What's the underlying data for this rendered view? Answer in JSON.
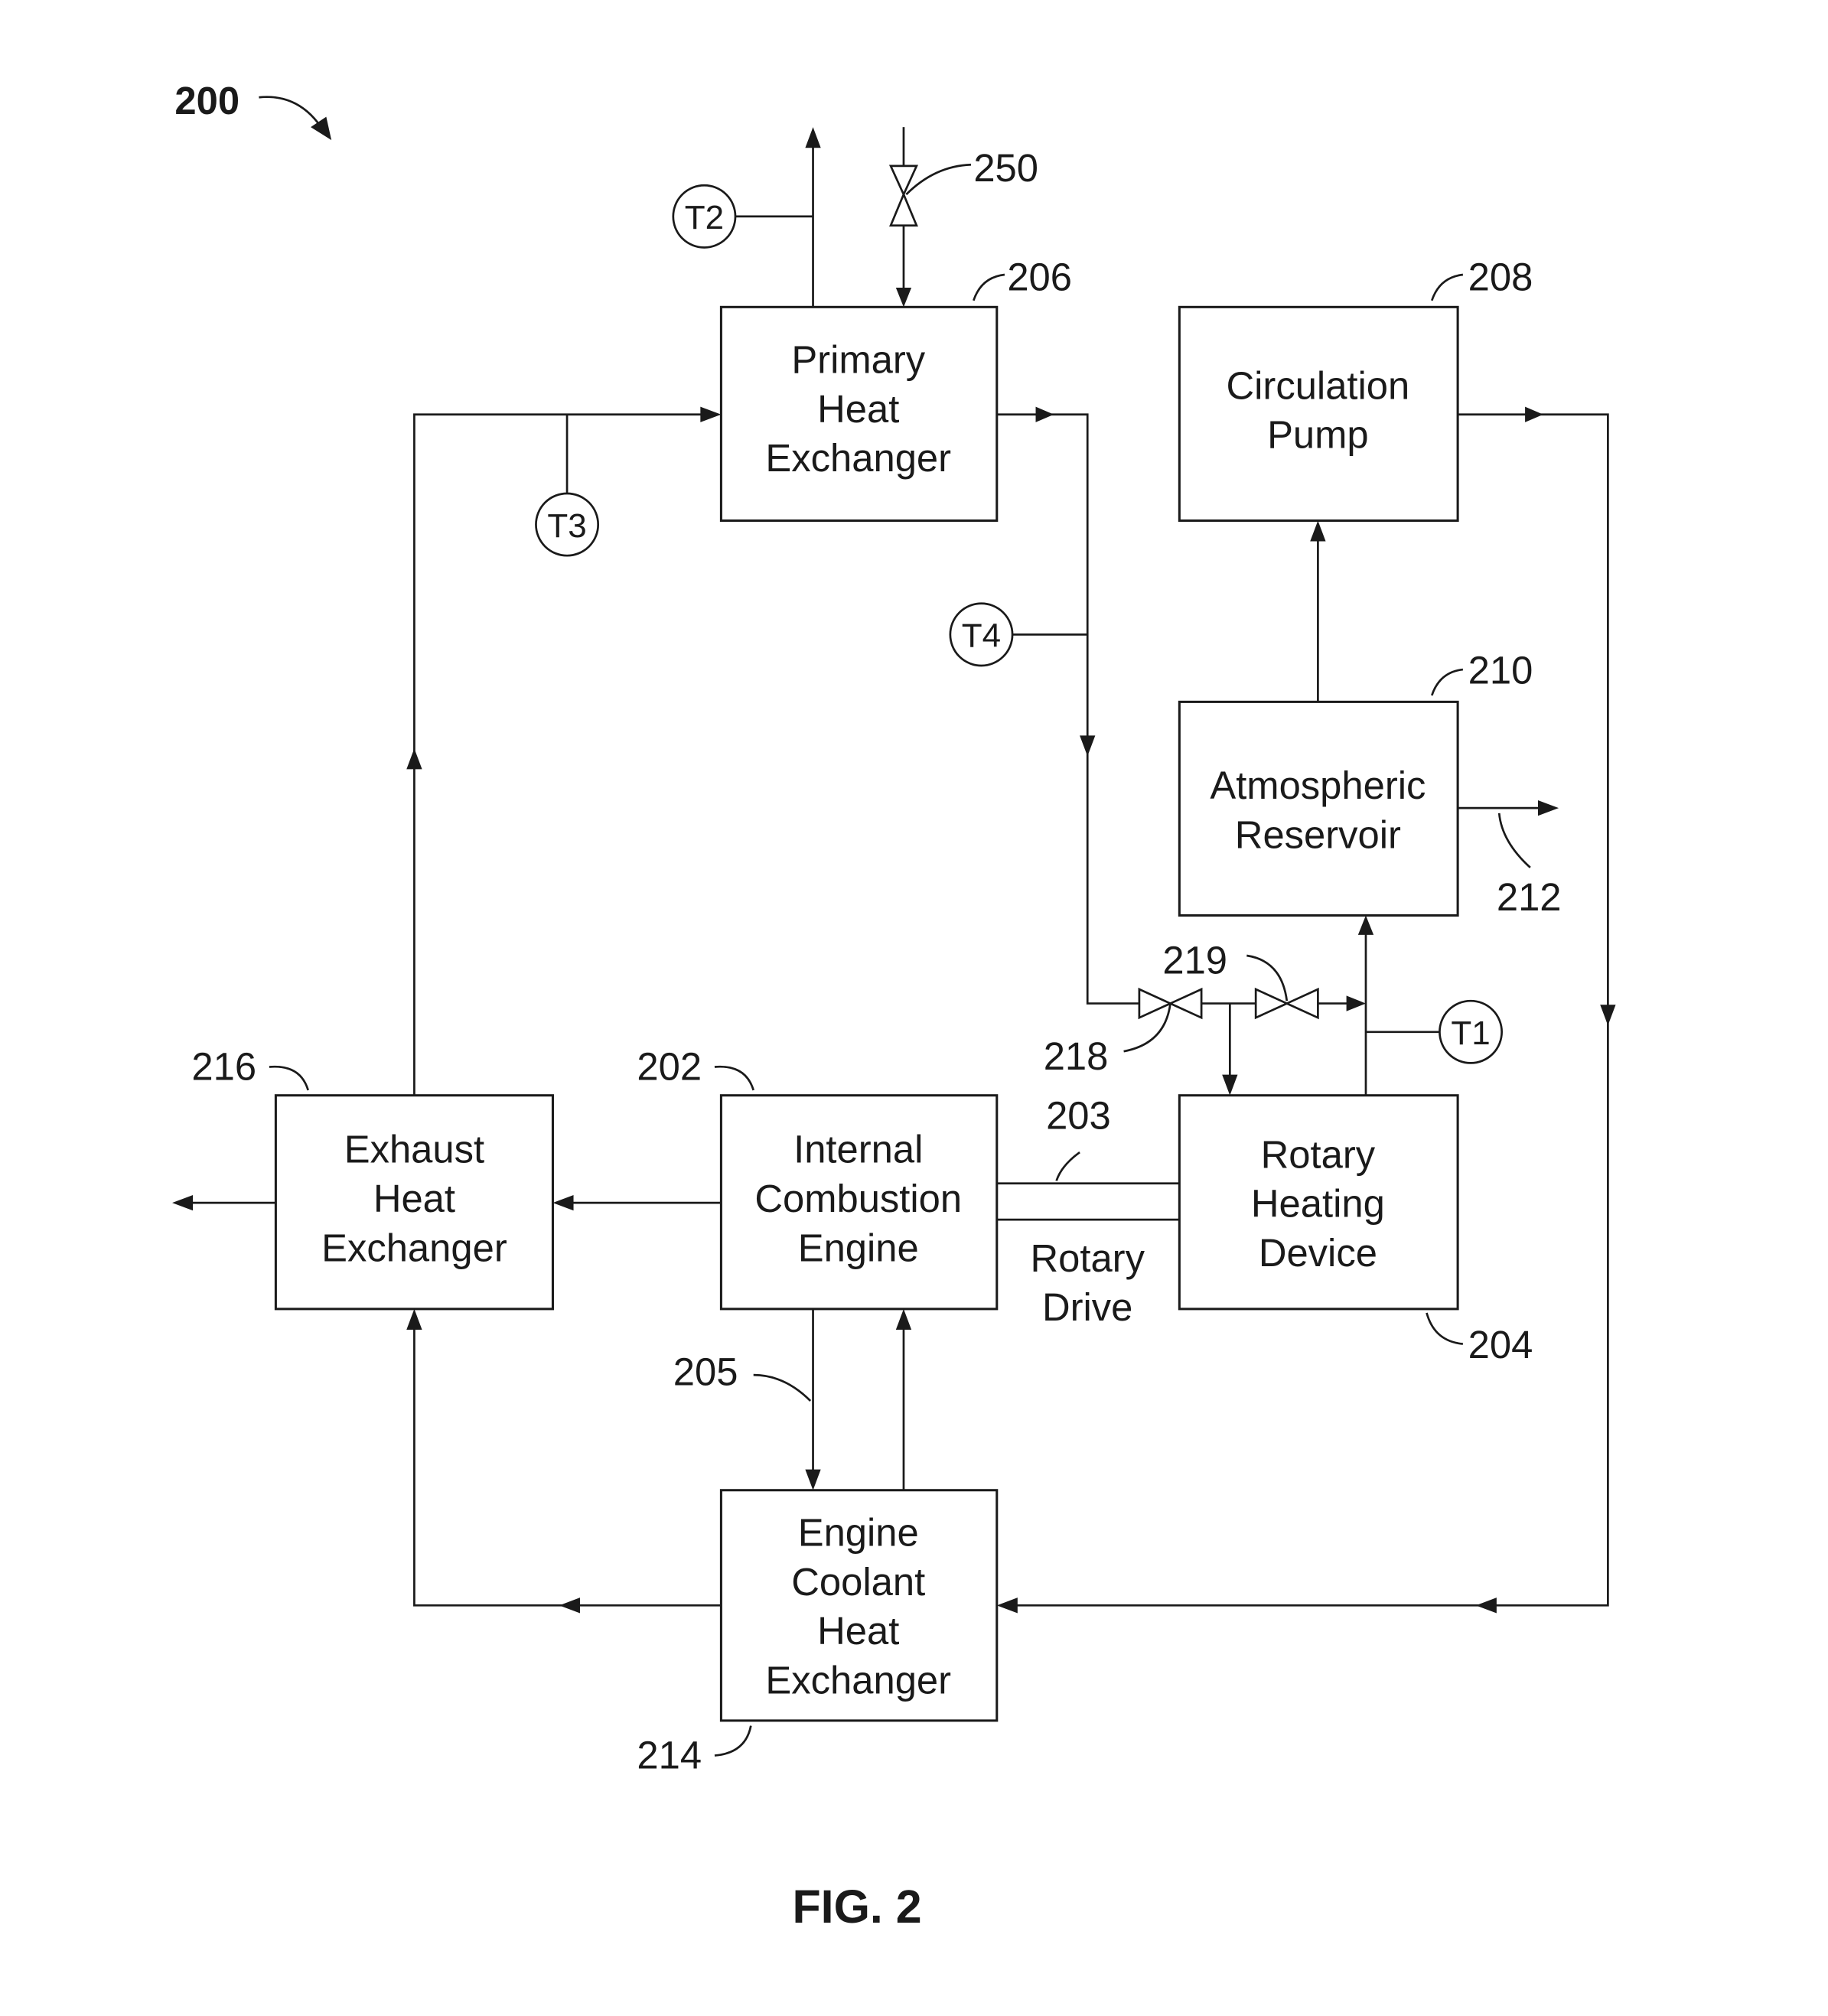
{
  "figure": {
    "number_label": "200",
    "caption": "FIG. 2"
  },
  "components": {
    "primary_hx": {
      "ref": "206",
      "lines": [
        "Primary",
        "Heat",
        "Exchanger"
      ]
    },
    "circulation_pump": {
      "ref": "208",
      "lines": [
        "Circulation",
        "Pump"
      ]
    },
    "atmospheric_reservoir": {
      "ref": "210",
      "lines": [
        "Atmospheric",
        "Reservoir"
      ]
    },
    "exhaust_hx": {
      "ref": "216",
      "lines": [
        "Exhaust",
        "Heat",
        "Exchanger"
      ]
    },
    "engine": {
      "ref": "202",
      "lines": [
        "Internal",
        "Combustion",
        "Engine"
      ]
    },
    "rotary_heater": {
      "ref": "204",
      "lines": [
        "Rotary",
        "Heating",
        "Device"
      ]
    },
    "coolant_hx": {
      "ref": "214",
      "lines": [
        "Engine",
        "Coolant",
        "Heat",
        "Exchanger"
      ]
    }
  },
  "connections": {
    "rotary_drive": {
      "ref": "203",
      "lines": [
        "Rotary",
        "Drive"
      ]
    },
    "engine_coolant_link": {
      "ref": "205"
    },
    "reservoir_vent": {
      "ref": "212"
    }
  },
  "valves": {
    "inlet_valve": {
      "ref": "250"
    },
    "valve_218": {
      "ref": "218"
    },
    "valve_219": {
      "ref": "219"
    }
  },
  "sensors": {
    "t1": "T1",
    "t2": "T2",
    "t3": "T3",
    "t4": "T4"
  }
}
